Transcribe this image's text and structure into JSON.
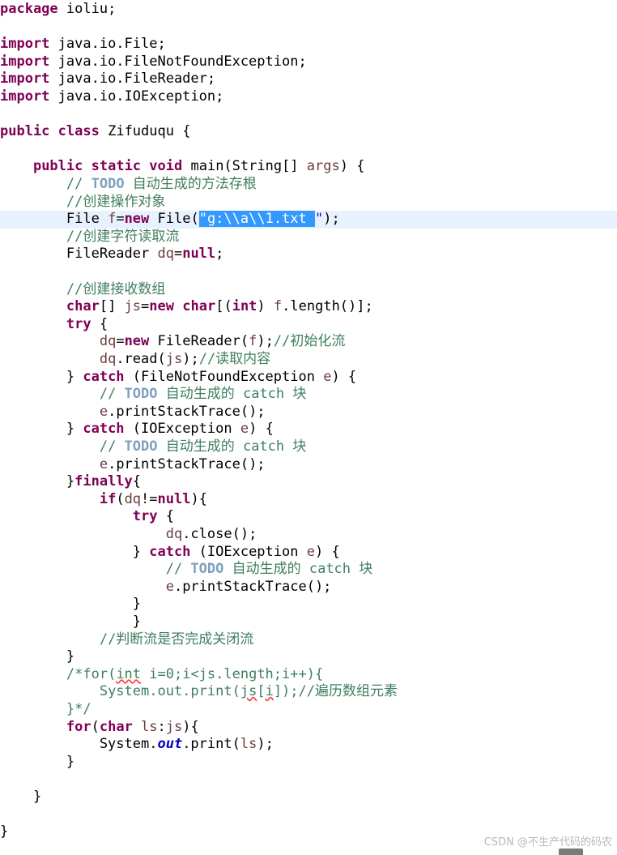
{
  "editor": {
    "language": "java",
    "highlighted_line_index": 12,
    "lines": [
      [
        {
          "t": "package",
          "c": "kw"
        },
        {
          "t": " ioliu;"
        }
      ],
      [],
      [
        {
          "t": "import",
          "c": "kw"
        },
        {
          "t": " java.io.File;"
        }
      ],
      [
        {
          "t": "import",
          "c": "kw"
        },
        {
          "t": " java.io.FileNotFoundException;"
        }
      ],
      [
        {
          "t": "import",
          "c": "kw"
        },
        {
          "t": " java.io.FileReader;"
        }
      ],
      [
        {
          "t": "import",
          "c": "kw"
        },
        {
          "t": " java.io.IOException;"
        }
      ],
      [],
      [
        {
          "t": "public",
          "c": "kw"
        },
        {
          "t": " "
        },
        {
          "t": "class",
          "c": "kw"
        },
        {
          "t": " Zifuduqu {"
        }
      ],
      [],
      [
        {
          "t": "    "
        },
        {
          "t": "public",
          "c": "kw"
        },
        {
          "t": " "
        },
        {
          "t": "static",
          "c": "kw"
        },
        {
          "t": " "
        },
        {
          "t": "void",
          "c": "kw"
        },
        {
          "t": " main(String[] "
        },
        {
          "t": "args",
          "c": "var"
        },
        {
          "t": ") {"
        }
      ],
      [
        {
          "t": "        "
        },
        {
          "t": "// ",
          "c": "cmt"
        },
        {
          "t": "TODO",
          "c": "todo"
        },
        {
          "t": " 自动生成的方法存根",
          "c": "cmt"
        }
      ],
      [
        {
          "t": "        "
        },
        {
          "t": "//创建操作对象",
          "c": "cmt"
        }
      ],
      [
        {
          "t": "        File "
        },
        {
          "t": "f",
          "c": "var"
        },
        {
          "t": "="
        },
        {
          "t": "new",
          "c": "kw"
        },
        {
          "t": " File("
        },
        {
          "t": "\"g:\\\\a\\\\1.txt ",
          "c": "sel"
        },
        {
          "t": "\"",
          "c": "str"
        },
        {
          "t": ");"
        }
      ],
      [
        {
          "t": "        "
        },
        {
          "t": "//创建字符读取流",
          "c": "cmt"
        }
      ],
      [
        {
          "t": "        FileReader "
        },
        {
          "t": "dq",
          "c": "var"
        },
        {
          "t": "="
        },
        {
          "t": "null",
          "c": "kw"
        },
        {
          "t": ";"
        }
      ],
      [],
      [
        {
          "t": "        "
        },
        {
          "t": "//创建接收数组",
          "c": "cmt"
        }
      ],
      [
        {
          "t": "        "
        },
        {
          "t": "char",
          "c": "kw"
        },
        {
          "t": "[] "
        },
        {
          "t": "js",
          "c": "var"
        },
        {
          "t": "="
        },
        {
          "t": "new",
          "c": "kw"
        },
        {
          "t": " "
        },
        {
          "t": "char",
          "c": "kw"
        },
        {
          "t": "[("
        },
        {
          "t": "int",
          "c": "kw"
        },
        {
          "t": ") "
        },
        {
          "t": "f",
          "c": "var"
        },
        {
          "t": ".length()];"
        }
      ],
      [
        {
          "t": "        "
        },
        {
          "t": "try",
          "c": "kw"
        },
        {
          "t": " {"
        }
      ],
      [
        {
          "t": "            "
        },
        {
          "t": "dq",
          "c": "var"
        },
        {
          "t": "="
        },
        {
          "t": "new",
          "c": "kw"
        },
        {
          "t": " FileReader("
        },
        {
          "t": "f",
          "c": "var"
        },
        {
          "t": ");"
        },
        {
          "t": "//初始化流",
          "c": "cmt"
        }
      ],
      [
        {
          "t": "            "
        },
        {
          "t": "dq",
          "c": "var"
        },
        {
          "t": ".read("
        },
        {
          "t": "js",
          "c": "var"
        },
        {
          "t": ");"
        },
        {
          "t": "//读取内容",
          "c": "cmt"
        }
      ],
      [
        {
          "t": "        } "
        },
        {
          "t": "catch",
          "c": "kw"
        },
        {
          "t": " (FileNotFoundException "
        },
        {
          "t": "e",
          "c": "var"
        },
        {
          "t": ") {"
        }
      ],
      [
        {
          "t": "            "
        },
        {
          "t": "// ",
          "c": "cmt"
        },
        {
          "t": "TODO",
          "c": "todo"
        },
        {
          "t": " 自动生成的 catch 块",
          "c": "cmt"
        }
      ],
      [
        {
          "t": "            "
        },
        {
          "t": "e",
          "c": "var"
        },
        {
          "t": ".printStackTrace();"
        }
      ],
      [
        {
          "t": "        } "
        },
        {
          "t": "catch",
          "c": "kw"
        },
        {
          "t": " (IOException "
        },
        {
          "t": "e",
          "c": "var"
        },
        {
          "t": ") {"
        }
      ],
      [
        {
          "t": "            "
        },
        {
          "t": "// ",
          "c": "cmt"
        },
        {
          "t": "TODO",
          "c": "todo"
        },
        {
          "t": " 自动生成的 catch 块",
          "c": "cmt"
        }
      ],
      [
        {
          "t": "            "
        },
        {
          "t": "e",
          "c": "var"
        },
        {
          "t": ".printStackTrace();"
        }
      ],
      [
        {
          "t": "        }"
        },
        {
          "t": "finally",
          "c": "kw"
        },
        {
          "t": "{"
        }
      ],
      [
        {
          "t": "            "
        },
        {
          "t": "if",
          "c": "kw"
        },
        {
          "t": "("
        },
        {
          "t": "dq",
          "c": "var"
        },
        {
          "t": "!="
        },
        {
          "t": "null",
          "c": "kw"
        },
        {
          "t": "){"
        }
      ],
      [
        {
          "t": "                "
        },
        {
          "t": "try",
          "c": "kw"
        },
        {
          "t": " {"
        }
      ],
      [
        {
          "t": "                    "
        },
        {
          "t": "dq",
          "c": "var"
        },
        {
          "t": ".close();"
        }
      ],
      [
        {
          "t": "                } "
        },
        {
          "t": "catch",
          "c": "kw"
        },
        {
          "t": " (IOException "
        },
        {
          "t": "e",
          "c": "var"
        },
        {
          "t": ") {"
        }
      ],
      [
        {
          "t": "                    "
        },
        {
          "t": "// ",
          "c": "cmt"
        },
        {
          "t": "TODO",
          "c": "todo"
        },
        {
          "t": " 自动生成的 catch 块",
          "c": "cmt"
        }
      ],
      [
        {
          "t": "                    "
        },
        {
          "t": "e",
          "c": "var"
        },
        {
          "t": ".printStackTrace();"
        }
      ],
      [
        {
          "t": "                }"
        }
      ],
      [
        {
          "t": "                }"
        }
      ],
      [
        {
          "t": "            "
        },
        {
          "t": "//判断流是否完成关闭流",
          "c": "cmt"
        }
      ],
      [
        {
          "t": "        }"
        }
      ],
      [
        {
          "t": "        "
        },
        {
          "t": "/*for(",
          "c": "cmt"
        },
        {
          "t": "int",
          "c": "cmt err"
        },
        {
          "t": " i=0;i<js.length;i++){",
          "c": "cmt"
        }
      ],
      [
        {
          "t": "            "
        },
        {
          "t": "System.out.print(",
          "c": "cmt"
        },
        {
          "t": "js",
          "c": "cmt err"
        },
        {
          "t": "[",
          "c": "cmt"
        },
        {
          "t": "i",
          "c": "cmt err"
        },
        {
          "t": "]);//遍历数组元素",
          "c": "cmt"
        }
      ],
      [
        {
          "t": "        "
        },
        {
          "t": "}*/",
          "c": "cmt"
        }
      ],
      [
        {
          "t": "        "
        },
        {
          "t": "for",
          "c": "kw"
        },
        {
          "t": "("
        },
        {
          "t": "char",
          "c": "kw"
        },
        {
          "t": " "
        },
        {
          "t": "ls",
          "c": "var"
        },
        {
          "t": ":"
        },
        {
          "t": "js",
          "c": "var"
        },
        {
          "t": "){"
        }
      ],
      [
        {
          "t": "            System."
        },
        {
          "t": "out",
          "c": "fld"
        },
        {
          "t": ".print("
        },
        {
          "t": "ls",
          "c": "var"
        },
        {
          "t": ");"
        }
      ],
      [
        {
          "t": "        }"
        }
      ],
      [],
      [
        {
          "t": "    }"
        }
      ],
      [],
      [
        {
          "t": "}"
        }
      ]
    ]
  },
  "watermark": {
    "text": "CSDN @不生产代码的码农"
  }
}
